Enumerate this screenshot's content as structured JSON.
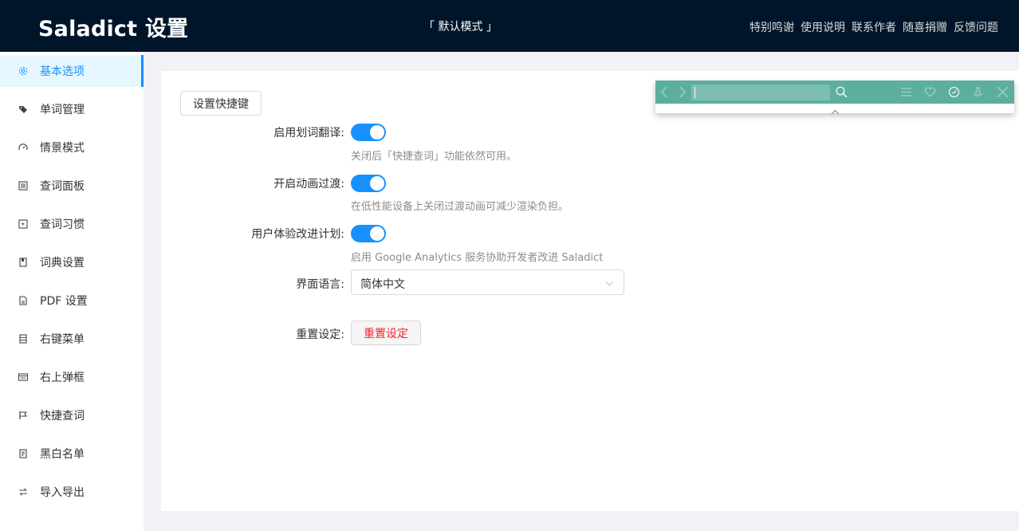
{
  "header": {
    "title": "Saladict 设置",
    "mode": "「 默认模式 」",
    "links": [
      "特别鸣谢",
      "使用说明",
      "联系作者",
      "随喜捐赠",
      "反馈问题"
    ]
  },
  "sidebar": {
    "items": [
      {
        "label": "基本选项",
        "icon": "gear-icon",
        "active": true
      },
      {
        "label": "单词管理",
        "icon": "tag-icon"
      },
      {
        "label": "情景模式",
        "icon": "dashboard-icon"
      },
      {
        "label": "查词面板",
        "icon": "list-icon"
      },
      {
        "label": "查词习惯",
        "icon": "select-icon"
      },
      {
        "label": "词典设置",
        "icon": "book-icon"
      },
      {
        "label": "PDF 设置",
        "icon": "file-icon"
      },
      {
        "label": "右键菜单",
        "icon": "menu-icon"
      },
      {
        "label": "右上弹框",
        "icon": "window-icon"
      },
      {
        "label": "快捷查词",
        "icon": "flag-icon"
      },
      {
        "label": "黑白名单",
        "icon": "filelist-icon"
      },
      {
        "label": "导入导出",
        "icon": "swap-icon"
      }
    ]
  },
  "form": {
    "shortcut_button": "设置快捷键",
    "selection": {
      "label": "启用划词翻译:",
      "on": true,
      "help": "关闭后「快捷查词」功能依然可用。"
    },
    "animation": {
      "label": "开启动画过渡:",
      "on": true,
      "help": "在低性能设备上关闭过渡动画可减少渲染负担。"
    },
    "analytics": {
      "label": "用户体验改进计划:",
      "on": true,
      "help": "启用 Google Analytics 服务协助开发者改进 Saladict"
    },
    "language": {
      "label": "界面语言:",
      "value": "简体中文"
    },
    "reset": {
      "label": "重置设定:",
      "button": "重置设定"
    }
  },
  "panel": {
    "accent": "#5caf9e",
    "icons": [
      "back-icon",
      "forward-icon",
      "search-icon",
      "menu-icon",
      "heart-icon",
      "history-icon",
      "pin-icon",
      "close-icon"
    ]
  },
  "colors": {
    "header_bg": "#001529",
    "primary": "#1890ff",
    "danger": "#f5222d"
  }
}
